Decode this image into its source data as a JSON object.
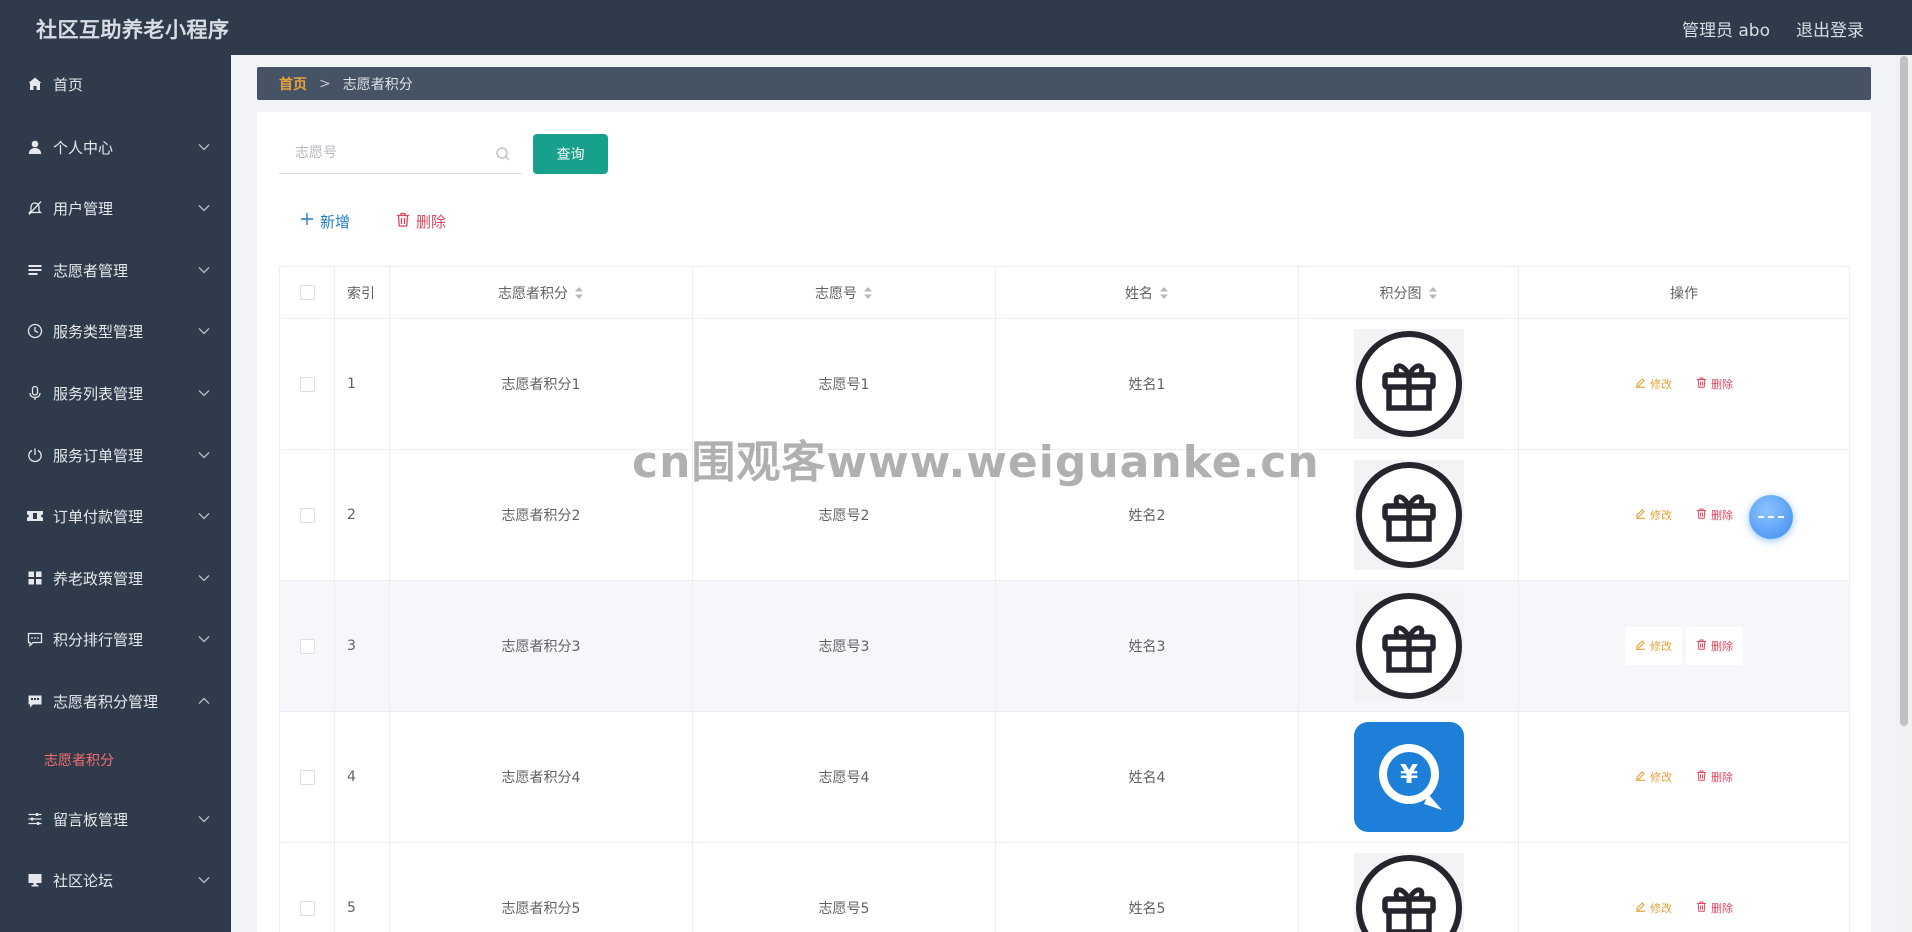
{
  "app": {
    "title": "社区互助养老小程序"
  },
  "header": {
    "user_label": "管理员 abo",
    "logout_label": "退出登录"
  },
  "sidebar": {
    "items": [
      {
        "label": "首页",
        "icon": "home-icon",
        "expandable": false
      },
      {
        "label": "个人中心",
        "icon": "user-icon",
        "expandable": true
      },
      {
        "label": "用户管理",
        "icon": "bell-off-icon",
        "expandable": true
      },
      {
        "label": "志愿者管理",
        "icon": "list-icon",
        "expandable": true
      },
      {
        "label": "服务类型管理",
        "icon": "clock-icon",
        "expandable": true
      },
      {
        "label": "服务列表管理",
        "icon": "microphone-icon",
        "expandable": true
      },
      {
        "label": "服务订单管理",
        "icon": "power-icon",
        "expandable": true
      },
      {
        "label": "订单付款管理",
        "icon": "ticket-icon",
        "expandable": true
      },
      {
        "label": "养老政策管理",
        "icon": "grid-icon",
        "expandable": true
      },
      {
        "label": "积分排行管理",
        "icon": "chat-icon",
        "expandable": true
      },
      {
        "label": "志愿者积分管理",
        "icon": "message-icon",
        "expandable": true,
        "expanded": true
      },
      {
        "label": "留言板管理",
        "icon": "sliders-icon",
        "expandable": true
      },
      {
        "label": "社区论坛",
        "icon": "monitor-icon",
        "expandable": true
      }
    ],
    "subitem_active": "志愿者积分"
  },
  "breadcrumb": {
    "home": "首页",
    "separator": ">",
    "current": "志愿者积分"
  },
  "search": {
    "placeholder": "志愿号",
    "value": "",
    "button_label": "查询"
  },
  "actions": {
    "add_label": "新增",
    "delete_label": "删除"
  },
  "table": {
    "columns": [
      "索引",
      "志愿者积分",
      "志愿号",
      "姓名",
      "积分图",
      "操作"
    ],
    "sortable": [
      false,
      true,
      true,
      true,
      true,
      false
    ],
    "rows": [
      {
        "index": "1",
        "score": "志愿者积分1",
        "vno": "志愿号1",
        "name": "姓名1",
        "image": "gift-icon"
      },
      {
        "index": "2",
        "score": "志愿者积分2",
        "vno": "志愿号2",
        "name": "姓名2",
        "image": "gift-icon"
      },
      {
        "index": "3",
        "score": "志愿者积分3",
        "vno": "志愿号3",
        "name": "姓名3",
        "image": "gift-icon",
        "hovered": true
      },
      {
        "index": "4",
        "score": "志愿者积分4",
        "vno": "志愿号4",
        "name": "姓名4",
        "image": "yuan-chat-icon"
      },
      {
        "index": "5",
        "score": "志愿者积分5",
        "vno": "志愿号5",
        "name": "姓名5",
        "image": "gift-icon"
      }
    ],
    "row_actions": {
      "edit_label": "修改",
      "delete_label": "删除"
    }
  },
  "watermark": "cn围观客www.weiguanke.cn",
  "colors": {
    "topbar": "#2f3b4b",
    "sidebar": "#2f3b4b",
    "active_submenu": "#f56c6c",
    "query_button": "#17a08c",
    "add_action": "#1f7fc4",
    "delete_action": "#d9485f",
    "edit_action": "#e6a23c"
  }
}
